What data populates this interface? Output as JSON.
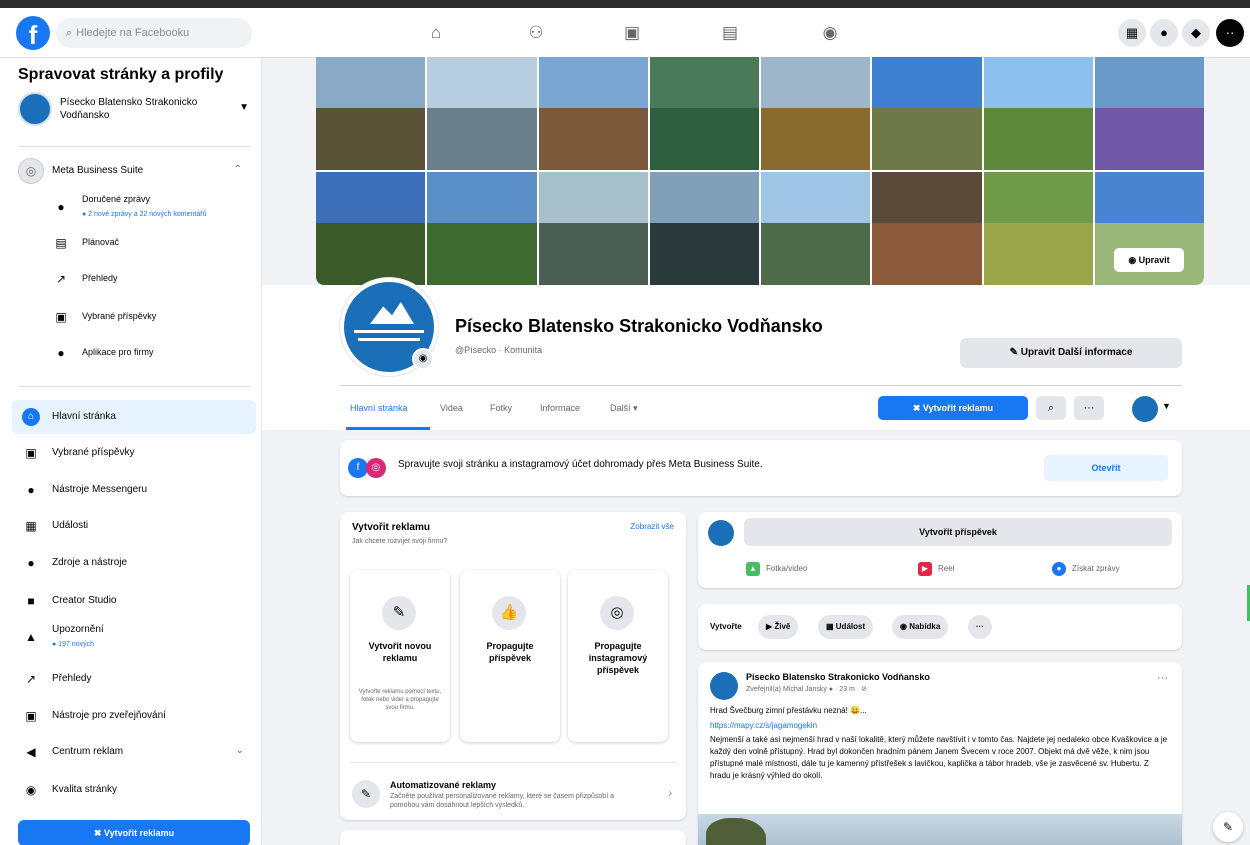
{
  "topbar": {
    "search_placeholder": "Hledejte na Facebooku",
    "logo": "f"
  },
  "sidebar": {
    "title": "Spravovat stránky a profily",
    "page_name": "Písecko Blatensko Strakonicko Vodňansko",
    "business_suite": "Meta Business Suite",
    "sub": [
      {
        "label": "Doručené zprávy",
        "detail": "● 2 nové zprávy a 22 nových komentářů",
        "icon": "●"
      },
      {
        "label": "Plánovač",
        "icon": "▤"
      },
      {
        "label": "Přehledy",
        "icon": "↗"
      },
      {
        "label": "Vybrané příspěvky",
        "icon": "▣"
      },
      {
        "label": "Aplikace pro firmy",
        "icon": "●"
      }
    ],
    "menu": [
      {
        "label": "Hlavní stránka",
        "icon": "⌂"
      },
      {
        "label": "Vybrané příspěvky",
        "icon": "▣"
      },
      {
        "label": "Nástroje Messengeru",
        "icon": "●"
      },
      {
        "label": "Události",
        "icon": "▦"
      },
      {
        "label": "Zdroje a nástroje",
        "icon": "●"
      },
      {
        "label": "Creator Studio",
        "icon": "■"
      },
      {
        "label": "Upozornění",
        "detail": "● 197 nových",
        "icon": "▲"
      },
      {
        "label": "Přehledy",
        "icon": "↗"
      },
      {
        "label": "Nástroje pro zveřejňování",
        "icon": "▣"
      },
      {
        "label": "Centrum reklam",
        "icon": "◀"
      },
      {
        "label": "Kvalita stránky",
        "icon": "◉"
      }
    ],
    "cta": "✖ Vytvořit reklamu"
  },
  "cover": {
    "edit_label": "◉ Upravit",
    "tiles": [
      {
        "sky": "#8aa9c4",
        "land": "#5a5236"
      },
      {
        "sky": "#b7cde0",
        "land": "#6b7f8c"
      },
      {
        "sky": "#7aa6d2",
        "land": "#7b5a3c"
      },
      {
        "sky": "#4b7a5b",
        "land": "#2f5f3f"
      },
      {
        "sky": "#9eb6c9",
        "land": "#8a6b2f"
      },
      {
        "sky": "#3f7fd0",
        "land": "#6d7a48"
      },
      {
        "sky": "#8ec0ee",
        "land": "#5c8a3a"
      },
      {
        "sky": "#6a9ac9",
        "land": "#6f58a8"
      },
      {
        "sky": "#3c6fb8",
        "land": "#3a5a2a"
      },
      {
        "sky": "#5a8fc8",
        "land": "#3d6a2f"
      },
      {
        "sky": "#a8bfcc",
        "land": "#4a5e54"
      },
      {
        "sky": "#7fa0b8",
        "land": "#2a3a3a"
      },
      {
        "sky": "#9fc4e4",
        "land": "#4f6b4a"
      },
      {
        "sky": "#5b4a3a",
        "land": "#8a5a3a"
      },
      {
        "sky": "#6f9a4a",
        "land": "#9aa64a"
      },
      {
        "sky": "#4a84d0",
        "land": "#9ab87a"
      }
    ]
  },
  "profile": {
    "name": "Písecko Blatensko Strakonicko Vodňansko",
    "handle": "@Písecko · Komunita",
    "edit_info": "✎ Upravit Další informace",
    "tabs": [
      "Hlavní stránka",
      "Videa",
      "Fotky",
      "Informace",
      "Další ▾"
    ],
    "ad_button": "✖ Vytvořit reklamu",
    "search_icon": "⌕",
    "more_icon": "···"
  },
  "banner": {
    "text": "Spravujte svoji stránku a instagramový účet dohromady přes Meta Business Suite.",
    "button": "Otevřít"
  },
  "create_ad": {
    "title": "Vytvořit reklamu",
    "subtitle": "Jak chcete rozvíjet svoji firmu?",
    "link": "Zobrazit vše",
    "options": [
      {
        "icon": "✎",
        "title": "Vytvořit novou reklamu",
        "desc": "Vytvořte reklamu pomocí textu, fotek nebo videí a propagujte svou firmu."
      },
      {
        "icon": "👍",
        "title": "Propagujte příspěvek",
        "desc": ""
      },
      {
        "icon": "◎",
        "title": "Propagujte instagramový příspěvek",
        "desc": ""
      }
    ],
    "auto_title": "Automatizované reklamy",
    "auto_desc": "Začněte používat personalizované reklamy, které se časem přizpůsobí a pomohou vám dosáhnout lepších výsledků."
  },
  "composer": {
    "button": "Vytvořit příspěvek",
    "actions": [
      {
        "label": "Fotka/video",
        "icon": "▲",
        "color": "#45bd62"
      },
      {
        "label": "Reel",
        "icon": "▶",
        "color": "#e42645"
      },
      {
        "label": "Získat zprávy",
        "icon": "●",
        "color": "#1877f2"
      }
    ]
  },
  "create_row": {
    "label": "Vytvořte",
    "chips": [
      "▶ Živě",
      "▦ Událost",
      "◉ Nabídka",
      "···"
    ]
  },
  "post": {
    "author": "Písecko Blatensko Strakonicko Vodňansko",
    "meta": "Zveřejnil(a) Michal Jansky ● · 23 m · ⊘",
    "line1": "Hrad Švečburg zimní přestávku nezná! 😀...",
    "link": "https://mapy.cz/s/jagamogekin",
    "body": "Nejmenší a také asi nejmenší hrad v naší lokalitě, který můžete navštívit i v tomto čas. Najdete jej nedaleko obce Kvaškovice a je každý den volně přístupný. Hrad byl dokončen hradním pánem Janem Švecem v roce 2007. Objekt má dvě věže, k nim jsou přístupné malé místnosti, dále tu je kamenný přístřešek s lavičkou, kaplička a tábor hradeb, vše je zasvěcené sv. Hubertu. Z hradu je krásný výhled do okolí."
  },
  "misc": {
    "fab_icon": "✎"
  },
  "colors": {
    "brand": "#1877f2",
    "page_avatar": "#1b6fb8",
    "background": "#f0f2f5"
  }
}
